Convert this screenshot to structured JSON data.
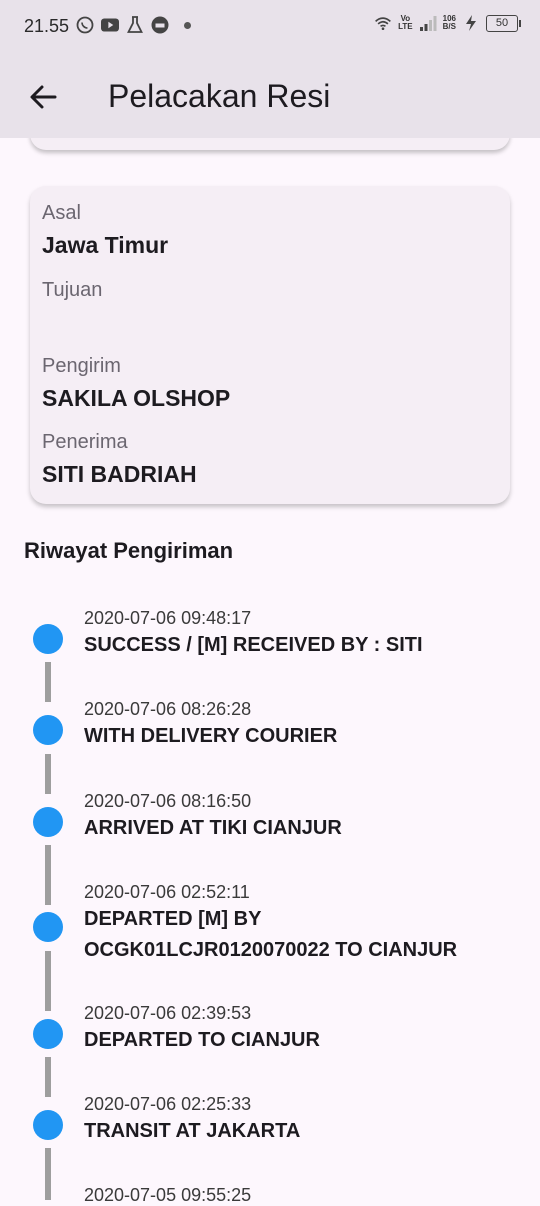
{
  "status_bar": {
    "time": "21.55",
    "network_label_top": "Vo",
    "network_label_bottom": "LTE",
    "speed_value": "106",
    "speed_unit": "B/S",
    "battery": "50"
  },
  "app_bar": {
    "title": "Pelacakan Resi"
  },
  "info": {
    "origin_label": "Asal",
    "origin_value": "Jawa Timur",
    "destination_label": "Tujuan",
    "destination_value": "",
    "sender_label": "Pengirim",
    "sender_value": "SAKILA OLSHOP",
    "receiver_label": "Penerima",
    "receiver_value": "SITI BADRIAH"
  },
  "history": {
    "title": "Riwayat Pengiriman",
    "items": [
      {
        "date": "2020-07-06 09:48:17",
        "desc": "SUCCESS / [M] RECEIVED BY : SITI"
      },
      {
        "date": "2020-07-06 08:26:28",
        "desc": "WITH DELIVERY COURIER"
      },
      {
        "date": "2020-07-06 08:16:50",
        "desc": "ARRIVED AT TIKI CIANJUR"
      },
      {
        "date": "2020-07-06 02:52:11",
        "desc": "DEPARTED [M] BY OCGK01LCJR0120070022 TO CIANJUR"
      },
      {
        "date": "2020-07-06 02:39:53",
        "desc": "DEPARTED TO CIANJUR"
      },
      {
        "date": "2020-07-06 02:25:33",
        "desc": "TRANSIT AT JAKARTA"
      },
      {
        "date": "2020-07-05 09:55:25",
        "desc": ""
      }
    ]
  },
  "colors": {
    "accent": "#2196f3",
    "timeline_line": "#9e9e9e",
    "app_bar_bg": "#e8e2ea",
    "card_bg": "#f5eef5"
  }
}
